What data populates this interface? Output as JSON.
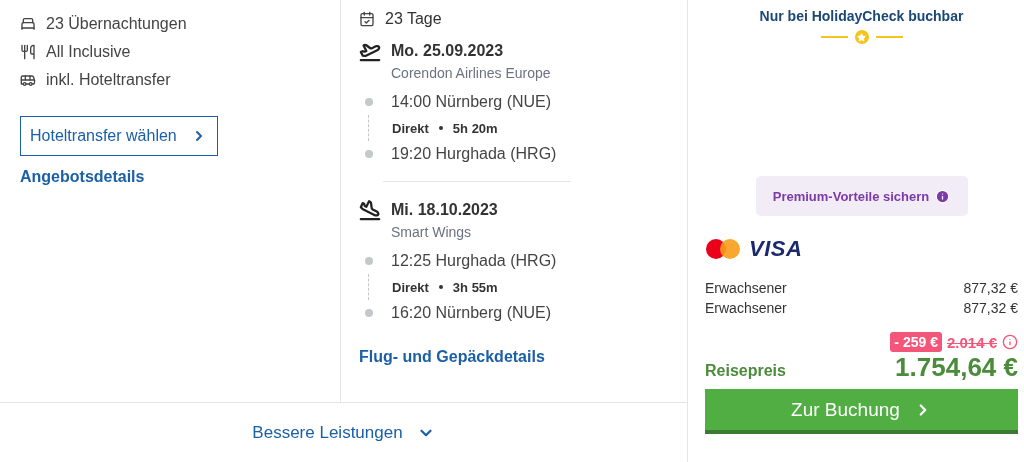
{
  "features": [
    {
      "kind": "bed",
      "label": "23 Übernachtungen"
    },
    {
      "kind": "meal",
      "label": "All Inclusive"
    },
    {
      "kind": "bus",
      "label": "inkl. Hoteltransfer"
    }
  ],
  "transfer_button": "Hoteltransfer wählen",
  "offer_link": "Angebotsdetails",
  "duration": "23 Tage",
  "flights": [
    {
      "kind": "outbound",
      "date": "Mo. 25.09.2023",
      "airline": "Corendon Airlines Europe",
      "departure": "14:00 Nürnberg (NUE)",
      "stops": "Direkt",
      "flight_time": "5h 20m",
      "arrival": "19:20 Hurghada (HRG)"
    },
    {
      "kind": "return",
      "date": "Mi. 18.10.2023",
      "airline": "Smart Wings",
      "departure": "12:25 Hurghada (HRG)",
      "stops": "Direkt",
      "flight_time": "3h 55m",
      "arrival": "16:20 Nürnberg (NUE)"
    }
  ],
  "flight_link": "Flug- und Gepäckdetails",
  "more_link": "Bessere Leistungen",
  "booking": {
    "badge": "Nur bei HolidayCheck buchbar",
    "premium": "Premium-Vorteile sichern",
    "visa_logo": "VISA",
    "travellers": [
      {
        "label": "Erwachsener",
        "price": "877,32 €"
      },
      {
        "label": "Erwachsener",
        "price": "877,32 €"
      }
    ],
    "discount": "- 259 €",
    "old_price": "2.014 €",
    "total_label": "Reisepreis",
    "total": "1.754,64 €",
    "book_button": "Zur Buchung"
  }
}
